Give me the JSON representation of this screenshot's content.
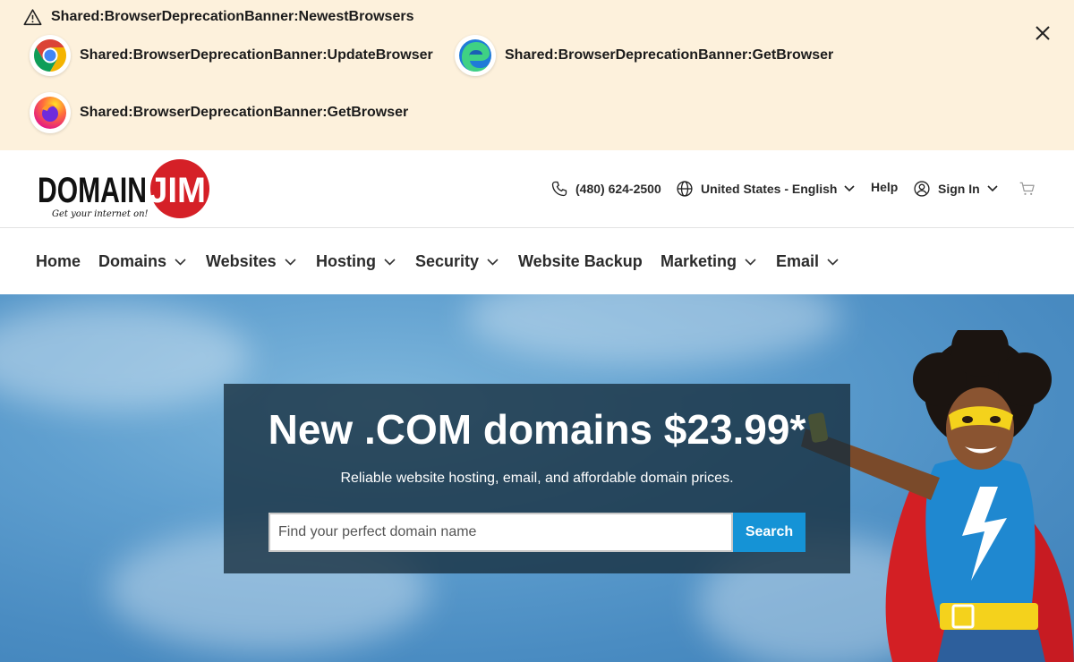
{
  "banner": {
    "title": "Shared:BrowserDeprecationBanner:NewestBrowsers",
    "browsers": [
      {
        "icon": "chrome-icon",
        "label": "Shared:BrowserDeprecationBanner:UpdateBrowser"
      },
      {
        "icon": "edge-icon",
        "label": "Shared:BrowserDeprecationBanner:GetBrowser"
      },
      {
        "icon": "firefox-icon",
        "label": "Shared:BrowserDeprecationBanner:GetBrowser"
      }
    ]
  },
  "header": {
    "logo": {
      "word1": "DOMAIN",
      "word2": "JIM",
      "tagline": "Get your internet on!"
    },
    "phone": "(480) 624-2500",
    "locale": "United States - English",
    "help": "Help",
    "signin": "Sign In"
  },
  "nav": {
    "items": [
      {
        "label": "Home",
        "dropdown": false
      },
      {
        "label": "Domains",
        "dropdown": true
      },
      {
        "label": "Websites",
        "dropdown": true
      },
      {
        "label": "Hosting",
        "dropdown": true
      },
      {
        "label": "Security",
        "dropdown": true
      },
      {
        "label": "Website Backup",
        "dropdown": false
      },
      {
        "label": "Marketing",
        "dropdown": true
      },
      {
        "label": "Email",
        "dropdown": true
      }
    ]
  },
  "hero": {
    "headline": "New .COM domains $23.99*",
    "subline": "Reliable website hosting, email, and affordable domain prices.",
    "search_placeholder": "Find your perfect domain name",
    "search_button": "Search"
  },
  "colors": {
    "banner_bg": "#fdf1dc",
    "accent": "#1593d6",
    "logo_red": "#d52027"
  }
}
